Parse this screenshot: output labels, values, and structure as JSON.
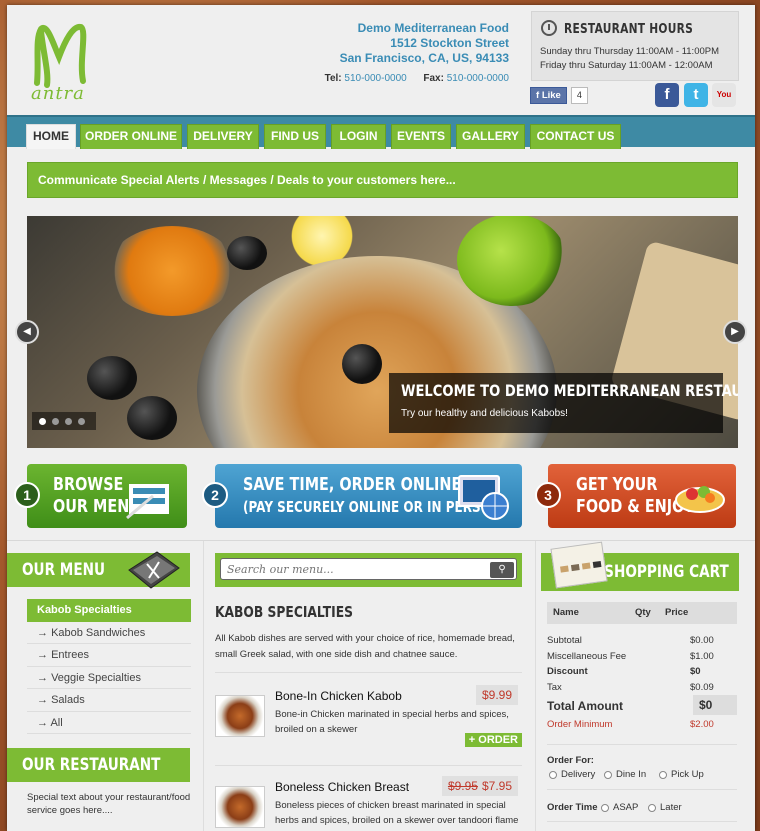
{
  "header": {
    "logo_text": "antra",
    "address": [
      "Demo Mediterranean Food",
      "1512 Stockton Street",
      "San Francisco, CA, US, 94133"
    ],
    "tel_label": "Tel:",
    "tel_value": "510-000-0000",
    "fax_label": "Fax:",
    "fax_value": "510-000-0000"
  },
  "hours": {
    "title": "RESTAURANT HOURS",
    "lines": [
      "Sunday thru Thursday 11:00AM - 11:00PM",
      "Friday thru Saturday 11:00AM - 12:00AM"
    ]
  },
  "social": {
    "like_label": "Like",
    "like_count": "4",
    "facebook": "f",
    "twitter": "t",
    "youtube": "You Tube"
  },
  "nav": [
    "HOME",
    "ORDER ONLINE",
    "DELIVERY",
    "FIND US",
    "LOGIN",
    "EVENTS",
    "GALLERY",
    "CONTACT US"
  ],
  "alert": "Communicate Special Alerts / Messages / Deals to your customers here...",
  "slider": {
    "caption_title": "WELCOME TO DEMO MEDITERRANEAN RESTAURANT",
    "caption_text": "Try our healthy and delicious Kabobs!",
    "prev": "◀",
    "next": "▶"
  },
  "cta": [
    {
      "num": "1",
      "line1": "BROWSE",
      "line2": "OUR MENU"
    },
    {
      "num": "2",
      "line1": "SAVE TIME, ORDER ONLINE",
      "line2": "(PAY SECURELY ONLINE OR IN PERSON)"
    },
    {
      "num": "3",
      "line1": "GET YOUR",
      "line2": "FOOD & ENJOY!"
    }
  ],
  "our_menu": {
    "title": "OUR MENU",
    "items": [
      "Kabob Specialties",
      "Kabob Sandwiches",
      "Entrees",
      "Veggie Specialties",
      "Salads",
      "All"
    ]
  },
  "our_restaurant": {
    "title": "OUR RESTAURANT",
    "text": "Special text about your restaurant/food service goes here...."
  },
  "search": {
    "placeholder": "Search our menu..."
  },
  "category": {
    "title": "KABOB SPECIALTIES",
    "description": "All Kabob dishes are served with your choice of rice, homemade bread, small Greek salad, with one side dish and chatnee sauce."
  },
  "menu_items": [
    {
      "name": "Bone-In Chicken Kabob",
      "price": "$9.99",
      "old_price": "",
      "desc": "Bone-in Chicken marinated in special herbs and spices, broiled on a skewer",
      "order": "+ ORDER"
    },
    {
      "name": "Boneless Chicken Breast",
      "price": "$7.95",
      "old_price": "$9.95",
      "desc": "Boneless pieces of chicken breast marinated in special herbs and spices, broiled on a skewer over tandoori flame",
      "order": "+ ORDER"
    }
  ],
  "cart": {
    "title": "SHOPPING CART",
    "columns": [
      "Name",
      "Qty",
      "Price"
    ],
    "rows": [
      {
        "label": "Subtotal",
        "value": "$0.00"
      },
      {
        "label": "Miscellaneous Fee",
        "value": "$1.00"
      },
      {
        "label": "Discount",
        "value": "$0"
      },
      {
        "label": "Tax",
        "value": "$0.09"
      }
    ],
    "total_label": "Total Amount",
    "total_value": "$0",
    "min_label": "Order Minimum",
    "min_value": "$2.00",
    "order_for_label": "Order For:",
    "order_for_options": [
      "Delivery",
      "Dine In",
      "Pick Up"
    ],
    "order_time_label": "Order Time",
    "order_time_options": [
      "ASAP",
      "Later"
    ]
  },
  "colors": {
    "green": "#7dbb34",
    "teal": "#3e8aa4",
    "blue": "#3a8cb5",
    "orange": "#d8532a",
    "red": "#c0392b"
  }
}
